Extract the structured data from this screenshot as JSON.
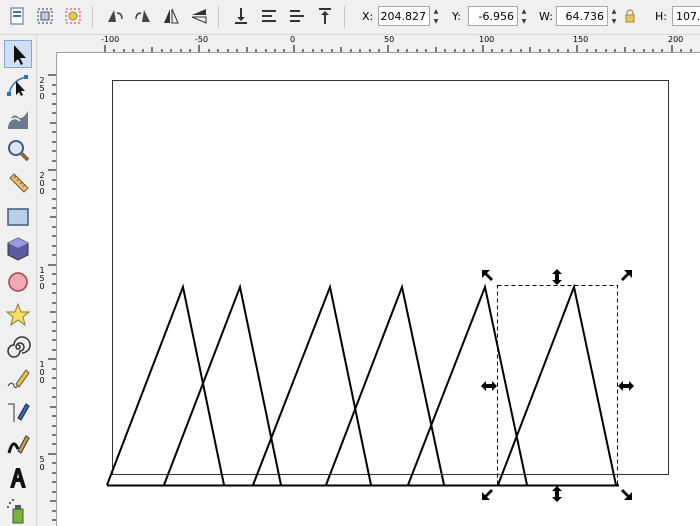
{
  "toolbar": {
    "x_label": "X:",
    "x_value": "204.827",
    "y_label": "Y:",
    "y_value": "-6.956",
    "w_label": "W:",
    "w_value": "64.736",
    "h_label": "H:",
    "h_value": "107."
  },
  "ruler": {
    "h_ticks": [
      "-100",
      "-50",
      "0",
      "50",
      "100",
      "150",
      "200"
    ],
    "v_ticks": [
      "250",
      "200",
      "150",
      "100",
      "50"
    ]
  },
  "tools": [
    "selector-tool",
    "node-tool",
    "tweak-tool",
    "zoom-tool",
    "measure-tool",
    "rectangle-tool",
    "3d-box-tool",
    "ellipse-tool",
    "star-tool",
    "spiral-tool",
    "pencil-tool",
    "pen-tool",
    "calligraphy-tool",
    "text-tool",
    "spray-tool"
  ],
  "colors": {
    "accent": "#2f6fc0",
    "selection_dash": "#000000"
  }
}
